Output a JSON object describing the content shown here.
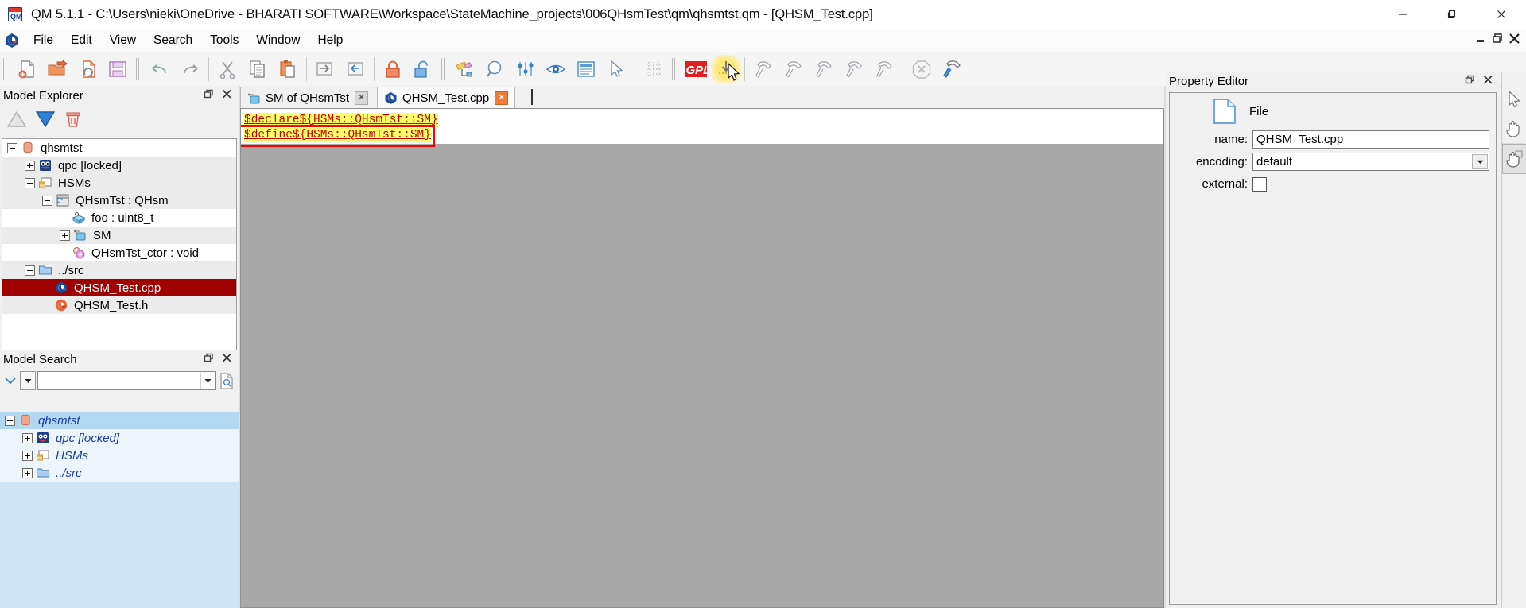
{
  "window": {
    "title": "QM 5.1.1 - C:\\Users\\nieki\\OneDrive - BHARATI SOFTWARE\\Workspace\\StateMachine_projects\\006QHsmTest\\qm\\qhsmtst.qm - [QHSM_Test.cpp]",
    "app_icon": "qm-app-icon",
    "minimize": "–",
    "maximize": "❐",
    "close": "✕",
    "mdi_restore": "❐",
    "mdi_minimize": "_",
    "mdi_close": "✕"
  },
  "menu": {
    "items": [
      {
        "label": "File"
      },
      {
        "label": "Edit"
      },
      {
        "label": "View"
      },
      {
        "label": "Search"
      },
      {
        "label": "Tools"
      },
      {
        "label": "Window"
      },
      {
        "label": "Help"
      }
    ]
  },
  "toolbar": {
    "groups": [
      {
        "name": "file",
        "buttons": [
          {
            "name": "new-document-button",
            "icon": "new-file-icon",
            "tooltip": "New"
          },
          {
            "name": "open-document-button",
            "icon": "open-folder-icon",
            "tooltip": "Open"
          },
          {
            "name": "reload-document-button",
            "icon": "reload-file-icon",
            "tooltip": "Reload"
          },
          {
            "name": "save-document-button",
            "icon": "floppy-save-icon",
            "tooltip": "Save"
          }
        ]
      },
      {
        "name": "edit",
        "buttons": [
          {
            "name": "undo-button",
            "icon": "undo-arrow-icon",
            "tooltip": "Undo"
          },
          {
            "name": "redo-button",
            "icon": "redo-arrow-icon",
            "tooltip": "Redo"
          },
          {
            "name": "cut-button",
            "icon": "scissors-icon",
            "tooltip": "Cut"
          },
          {
            "name": "copy-button",
            "icon": "copy-pages-icon",
            "tooltip": "Copy"
          },
          {
            "name": "paste-button",
            "icon": "clipboard-paste-icon",
            "tooltip": "Paste"
          },
          {
            "name": "export-button",
            "icon": "arrow-right-box-icon",
            "tooltip": "Export"
          },
          {
            "name": "import-button",
            "icon": "arrow-left-box-icon",
            "tooltip": "Import"
          },
          {
            "name": "lock-button",
            "icon": "lock-closed-icon",
            "tooltip": "Lock"
          },
          {
            "name": "unlock-button",
            "icon": "lock-open-icon",
            "tooltip": "Unlock"
          }
        ]
      },
      {
        "name": "view",
        "buttons": [
          {
            "name": "diagram-tool-button",
            "icon": "pencil-eraser-icon",
            "tooltip": "Diagram tools"
          },
          {
            "name": "zoom-button",
            "icon": "magnifier-icon",
            "tooltip": "Zoom"
          },
          {
            "name": "settings-sliders-button",
            "icon": "sliders-icon",
            "tooltip": "Preferences"
          },
          {
            "name": "show-hide-button",
            "icon": "eye-icon",
            "tooltip": "Show/Hide"
          },
          {
            "name": "document-view-button",
            "icon": "document-lines-icon",
            "tooltip": "Document view"
          },
          {
            "name": "select-pointer-button",
            "icon": "arrow-pointer-icon",
            "tooltip": "Select"
          },
          {
            "name": "grid-button",
            "icon": "grid-dots-icon",
            "tooltip": "Grid"
          }
        ]
      },
      {
        "name": "build",
        "buttons": [
          {
            "name": "gpl-button",
            "icon": "gpl-icon",
            "label": "GPL",
            "tooltip": "GPL"
          },
          {
            "name": "generate-code-button",
            "icon": "generate-code-icon",
            "tooltip": "Generate code",
            "highlighted": true
          },
          {
            "name": "build-1-button",
            "icon": "hammer-icon",
            "tooltip": "Build"
          },
          {
            "name": "build-2-button",
            "icon": "hammer-icon",
            "tooltip": "Build"
          },
          {
            "name": "build-3-button",
            "icon": "hammer-icon",
            "tooltip": "Build"
          },
          {
            "name": "build-4-button",
            "icon": "hammer-icon",
            "tooltip": "Build"
          },
          {
            "name": "build-5-button",
            "icon": "hammer-icon",
            "tooltip": "Build"
          },
          {
            "name": "stop-build-button",
            "icon": "stop-x-octagon-icon",
            "tooltip": "Stop"
          },
          {
            "name": "tools-config-button",
            "icon": "hammer-wrench-icon",
            "tooltip": "Configure tools"
          }
        ]
      }
    ],
    "cursor_glyph": "mouse-cursor"
  },
  "model_explorer": {
    "title": "Model Explorer",
    "buttons": [
      {
        "name": "move-up-button",
        "icon": "triangle-up-icon"
      },
      {
        "name": "move-down-button",
        "icon": "triangle-down-icon"
      },
      {
        "name": "delete-button",
        "icon": "trash-icon"
      }
    ],
    "panel_restore": "❐",
    "panel_close": "✕",
    "tree": [
      {
        "label": "qhsmtst",
        "icon": "model-cylinder-icon",
        "indent": 0,
        "expander": "minus",
        "state": "normal"
      },
      {
        "label": "qpc [locked]",
        "icon": "package-qpc-icon",
        "indent": 1,
        "expander": "plus",
        "state": "alt"
      },
      {
        "label": "HSMs",
        "icon": "folder-package-icon",
        "indent": 1,
        "expander": "minus",
        "state": "alt"
      },
      {
        "label": "QHsmTst : QHsm",
        "icon": "class-icon",
        "indent": 2,
        "expander": "minus",
        "state": "alt"
      },
      {
        "label": "foo : uint8_t",
        "icon": "attribute-lock-icon",
        "indent": 3,
        "expander": "none",
        "state": "normal"
      },
      {
        "label": "SM",
        "icon": "statemachine-icon",
        "indent": 3,
        "expander": "plus",
        "state": "alt"
      },
      {
        "label": "QHsmTst_ctor : void",
        "icon": "operation-gear-icon",
        "indent": 3,
        "expander": "none",
        "state": "normal"
      },
      {
        "label": "../src",
        "icon": "folder-icon",
        "indent": 1,
        "expander": "minus",
        "state": "alt"
      },
      {
        "label": "QHSM_Test.cpp",
        "icon": "cpp-file-icon",
        "indent": 2,
        "expander": "none",
        "state": "selected"
      },
      {
        "label": "QHSM_Test.h",
        "icon": "h-file-icon",
        "indent": 2,
        "expander": "none",
        "state": "alt"
      }
    ]
  },
  "model_search": {
    "title": "Model Search",
    "panel_restore": "❐",
    "panel_close": "✕",
    "scope_icon": "chevron-down-icon",
    "dropdown_icon": "caret-down-icon",
    "search_value": "",
    "search_placeholder": "",
    "open_file_icon": "document-search-icon",
    "results": [
      {
        "label": "qhsmtst",
        "icon": "model-cylinder-icon",
        "indent": 0,
        "expander": "minus",
        "state": "selected"
      },
      {
        "label": "qpc [locked]",
        "icon": "package-qpc-icon",
        "indent": 1,
        "expander": "plus",
        "state": "row"
      },
      {
        "label": "HSMs",
        "icon": "folder-package-icon",
        "indent": 1,
        "expander": "plus",
        "state": "row"
      },
      {
        "label": "../src",
        "icon": "folder-icon",
        "indent": 1,
        "expander": "plus",
        "state": "row"
      }
    ]
  },
  "editor": {
    "tabs": [
      {
        "label": "SM of QHsmTst",
        "icon": "statemachine-icon",
        "close": "✕",
        "active": false,
        "close_style": "gray"
      },
      {
        "label": "QHSM_Test.cpp",
        "icon": "cpp-file-icon",
        "close": "✕",
        "active": true,
        "close_style": "orange"
      }
    ],
    "code_lines": [
      {
        "text": "$declare${HSMs::QHsmTst::SM}",
        "highlighted": true,
        "annotated": false
      },
      {
        "text": "$define${HSMs::QHsmTst::SM}",
        "highlighted": true,
        "annotated": true
      }
    ],
    "annotation": {
      "name": "red-highlight-box",
      "color": "#ff0000"
    }
  },
  "property_editor": {
    "title": "Property Editor",
    "panel_restore": "❐",
    "panel_close": "✕",
    "type_icon": "file-page-icon",
    "type_label": "File",
    "fields": [
      {
        "label": "name:",
        "value": "QHSM_Test.cpp",
        "kind": "text"
      },
      {
        "label": "encoding:",
        "value": "default",
        "kind": "select"
      },
      {
        "label": "external:",
        "value": "",
        "kind": "checkbox",
        "checked": false
      }
    ]
  },
  "right_strip": {
    "buttons": [
      {
        "name": "select-arrow-tool",
        "icon": "arrow-pointer-icon",
        "selected": false
      },
      {
        "name": "pan-hand-tool",
        "icon": "open-hand-icon",
        "selected": false
      },
      {
        "name": "touch-hand-tool",
        "icon": "touch-hand-icon",
        "selected": true
      }
    ]
  },
  "colors": {
    "selection_red": "#a00000",
    "highlight_yellow": "#ffff66",
    "code_red": "#c00000",
    "annotation_red": "#ff0000",
    "search_blue": "#b4d8f0",
    "toolbar_highlight": "#ffe97a"
  }
}
